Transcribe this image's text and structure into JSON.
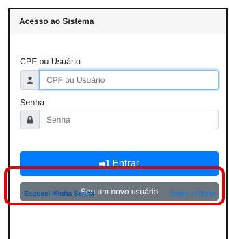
{
  "card": {
    "title": "Acesso ao Sistema"
  },
  "user": {
    "label": "CPF ou Usuário",
    "placeholder": "CPF ou Usuário",
    "icon": "user-icon"
  },
  "password": {
    "label": "Senha",
    "placeholder": "Senha",
    "icon": "lock-icon"
  },
  "login_button": {
    "label": "Entrar",
    "icon": "sign-in-icon"
  },
  "new_user_button": {
    "label": "Sou um novo usuário"
  },
  "links": {
    "forgot": "Esqueci Minha Senha",
    "about": "Sobre o PBdoc"
  },
  "colors": {
    "primary": "#007bff",
    "secondary": "#6c757d",
    "highlight": "#e50000"
  }
}
